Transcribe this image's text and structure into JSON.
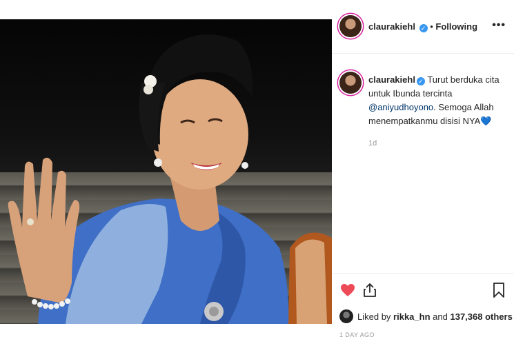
{
  "post": {
    "image_alt": "Woman in blue kebaya waving",
    "header": {
      "username": "claurakiehl",
      "verified_glyph": "✓",
      "separator": "•",
      "follow_status": "Following",
      "more_glyph": "•••"
    },
    "caption": {
      "username": "claurakiehl",
      "text_before": "Turut berduka cita untuk Ibunda tercinta ",
      "mention": "@aniyudhoyono",
      "text_after": ". Semoga Allah menempatkanmu disisi NYA",
      "emoji": "💙",
      "time": "1d"
    },
    "actions": {
      "like_icon": "heart-icon",
      "share_icon": "share-icon",
      "save_icon": "bookmark-icon",
      "liked_by_prefix": "Liked by",
      "liked_by_user": "rikka_hn",
      "liked_by_middle": "and",
      "liked_by_count": "137,368 others",
      "posted_ago": "1 DAY AGO"
    },
    "colors": {
      "like_red": "#ed4956",
      "verified_blue": "#3897f0",
      "story_ring": "#d6249f"
    }
  }
}
